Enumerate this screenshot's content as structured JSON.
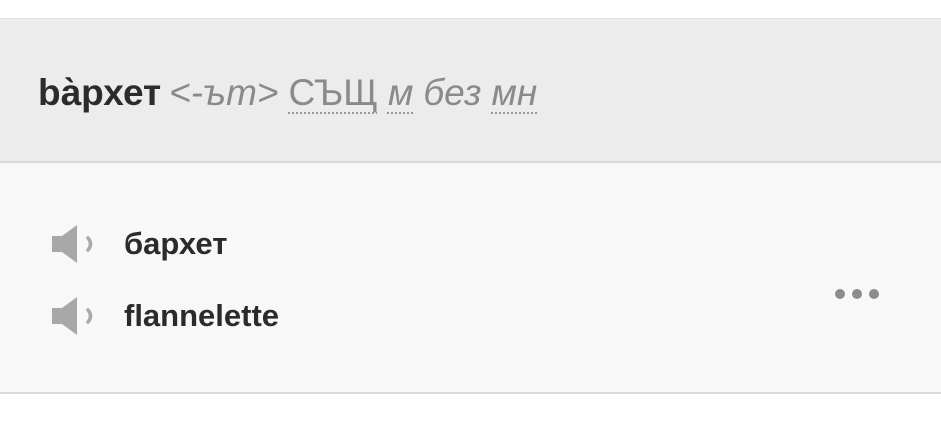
{
  "entry": {
    "headword": "bа̀рхет",
    "inflection": "<-ът>",
    "part_of_speech": "СЪЩ",
    "gender": "м",
    "without": "без",
    "plural_abbr": "мн"
  },
  "translations": [
    {
      "text": "бархет",
      "icon": "speaker-icon"
    },
    {
      "text": "flannelette",
      "icon": "speaker-icon"
    }
  ],
  "more_icon": "ellipsis-icon",
  "colors": {
    "header_bg": "#ececec",
    "body_bg": "#f8f8f8",
    "text_dark": "#2b2b2b",
    "text_muted": "#8a8a8a",
    "icon_gray": "#a8a8a8"
  }
}
